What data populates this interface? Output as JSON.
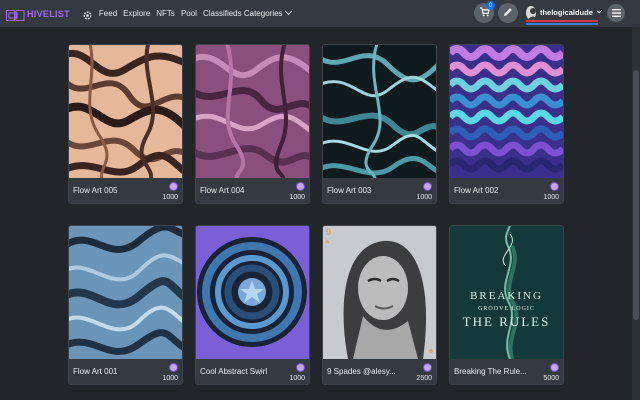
{
  "brand": {
    "name": "HIVELIST",
    "color": "#a56bf0"
  },
  "nav": {
    "settings_icon": "gear-icon",
    "links": [
      "Feed",
      "Explore",
      "NFTs",
      "Pool"
    ],
    "dropdown": "Classifieds Categories"
  },
  "header": {
    "cart_count": "0",
    "cart_icon": "cart-icon",
    "edit_icon": "pencil-icon",
    "menu_icon": "hamburger-icon",
    "username": "thelogicaldude",
    "vp_color": "#d63447",
    "rc_color": "#3d7be0"
  },
  "cards": [
    {
      "name": "Flow Art 005",
      "price": "1000",
      "art": "peach-flow"
    },
    {
      "name": "Flow Art 004",
      "price": "1000",
      "art": "purple-flow"
    },
    {
      "name": "Flow Art 003",
      "price": "1000",
      "art": "teal-flow"
    },
    {
      "name": "Flow Art 002",
      "price": "1000",
      "art": "wave-flow"
    },
    {
      "name": "Flow Art 001",
      "price": "1000",
      "art": "blue-flow"
    },
    {
      "name": "Cool Abstract Swirl",
      "price": "1000",
      "art": "swirl"
    },
    {
      "name": "9 Spades @alesy...",
      "price": "2500",
      "art": "portrait",
      "corner_label": "9"
    },
    {
      "name": "Breaking The Rule...",
      "price": "5000",
      "art": "album",
      "album_lines": [
        "BREAKING",
        "GROOVE LOGIC",
        "THE RULES"
      ]
    }
  ]
}
